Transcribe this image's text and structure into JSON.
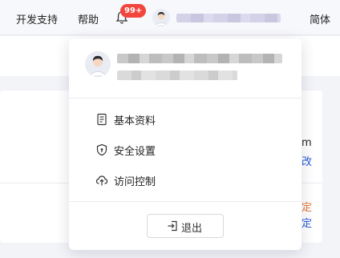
{
  "header": {
    "nav": [
      "开发支持",
      "帮助"
    ],
    "notification_badge": "99+",
    "language": "简体"
  },
  "background": {
    "right_texts": [
      "m",
      "改",
      "定",
      "定"
    ],
    "colors": {
      "link": "#2b5cd6",
      "warning": "#e8762c"
    }
  },
  "dropdown": {
    "menu": [
      {
        "label": "基本资料",
        "icon": "document-icon"
      },
      {
        "label": "安全设置",
        "icon": "shield-icon"
      },
      {
        "label": "访问控制",
        "icon": "cloud-upload-icon"
      }
    ],
    "logout_label": "退出"
  },
  "colors": {
    "badge": "#f2453c",
    "topbar_bg": "#f7f8fb",
    "page_bg": "#f3f4f8"
  }
}
